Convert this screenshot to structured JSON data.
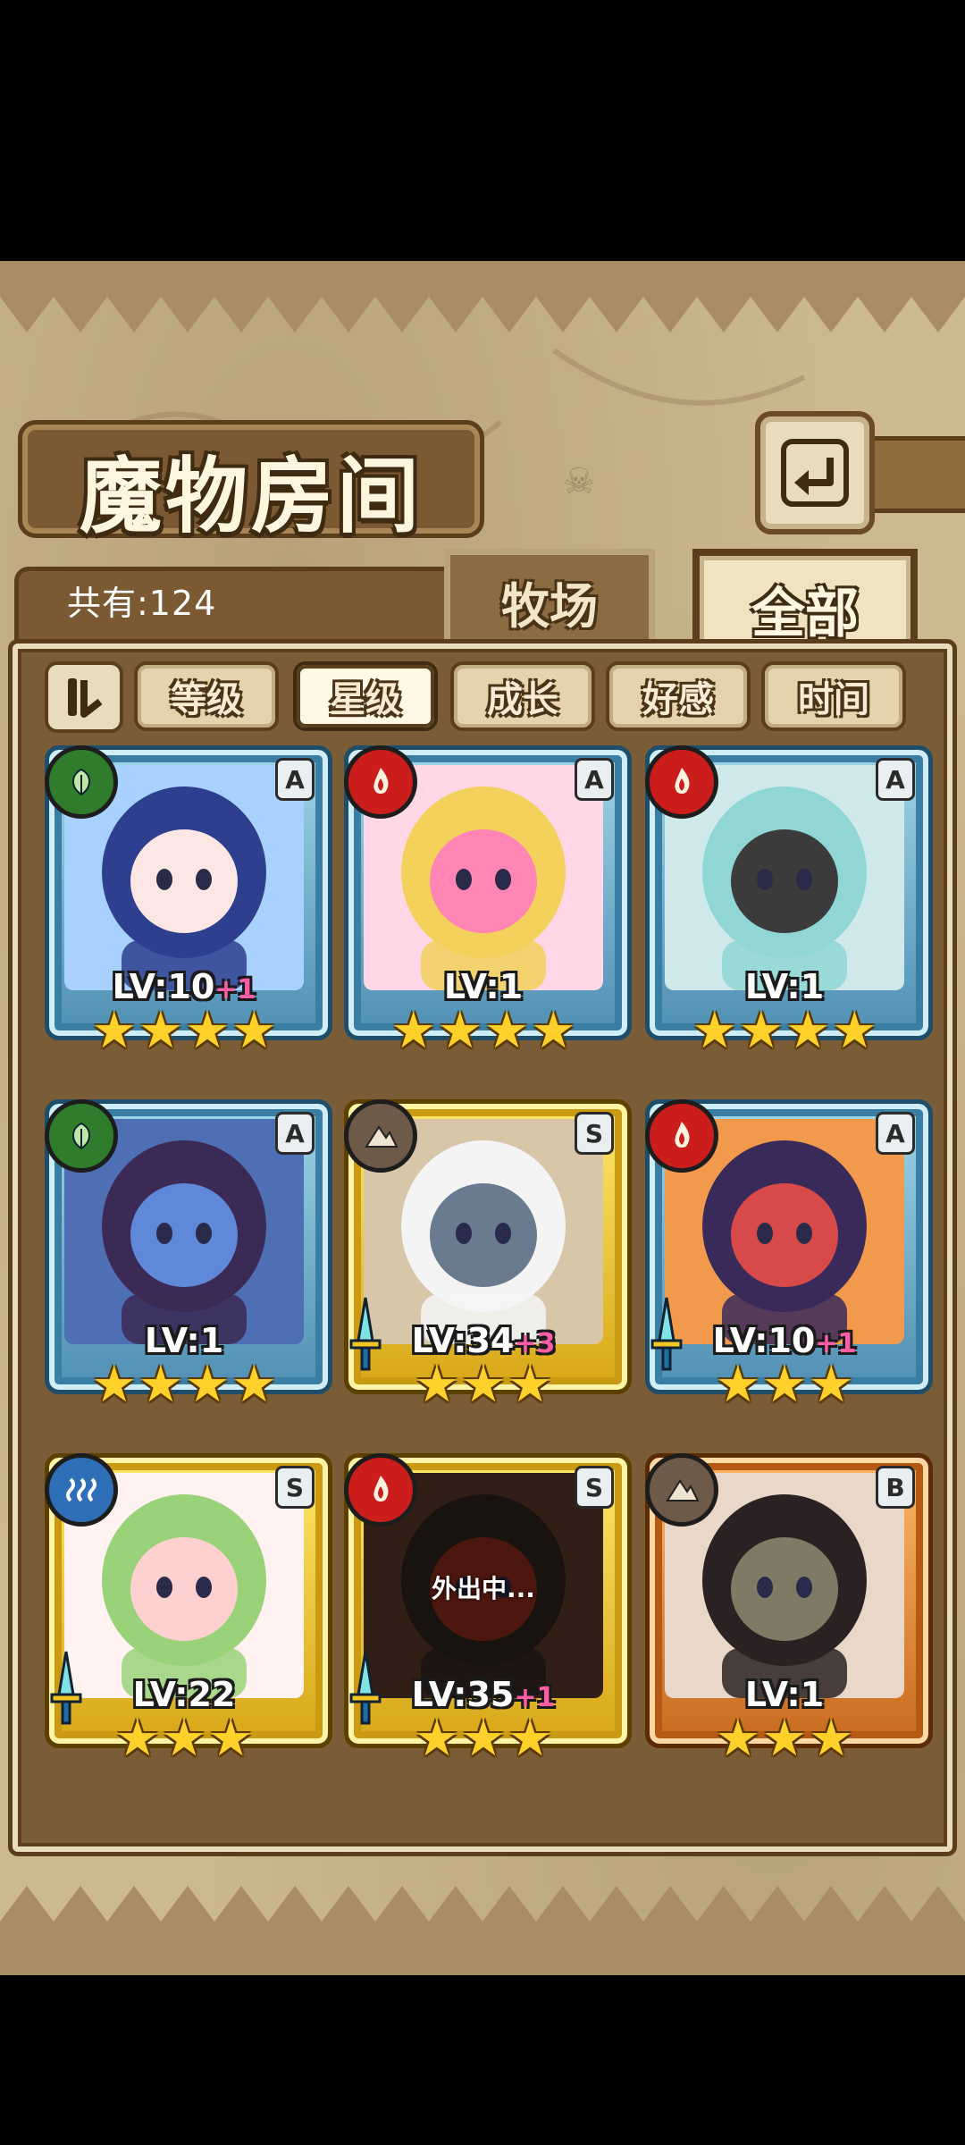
{
  "title": "魔物房间",
  "count": "共有:124",
  "tabs": {
    "ranch": "牧场",
    "all": "全部"
  },
  "sort": {
    "toggle_icon": "sort-toggle-icon",
    "buttons": [
      "等级",
      "星级",
      "成长",
      "好感",
      "时间"
    ],
    "active": "星级"
  },
  "monsters": [
    {
      "element": "leaf",
      "rank": "A",
      "frame": "blue",
      "lv": "LV:10",
      "bonus": "+1",
      "stars": 4,
      "status": ""
    },
    {
      "element": "fire",
      "rank": "A",
      "frame": "blue",
      "lv": "LV:1",
      "bonus": "",
      "stars": 4,
      "status": ""
    },
    {
      "element": "fire",
      "rank": "A",
      "frame": "blue",
      "lv": "LV:1",
      "bonus": "",
      "stars": 4,
      "status": ""
    },
    {
      "element": "leaf",
      "rank": "A",
      "frame": "blue",
      "lv": "LV:1",
      "bonus": "",
      "stars": 4,
      "status": ""
    },
    {
      "element": "earth",
      "rank": "S",
      "frame": "gold",
      "lv": "LV:34",
      "bonus": "+3",
      "stars": 3,
      "status": ""
    },
    {
      "element": "fire",
      "rank": "A",
      "frame": "blue",
      "lv": "LV:10",
      "bonus": "+1",
      "stars": 3,
      "status": ""
    },
    {
      "element": "water",
      "rank": "S",
      "frame": "gold",
      "lv": "LV:22",
      "bonus": "",
      "stars": 3,
      "status": ""
    },
    {
      "element": "fire",
      "rank": "S",
      "frame": "gold",
      "lv": "LV:35",
      "bonus": "+1",
      "stars": 3,
      "status": "外出中..."
    },
    {
      "element": "earth",
      "rank": "B",
      "frame": "bronze",
      "lv": "LV:1",
      "bonus": "",
      "stars": 3,
      "status": ""
    }
  ]
}
